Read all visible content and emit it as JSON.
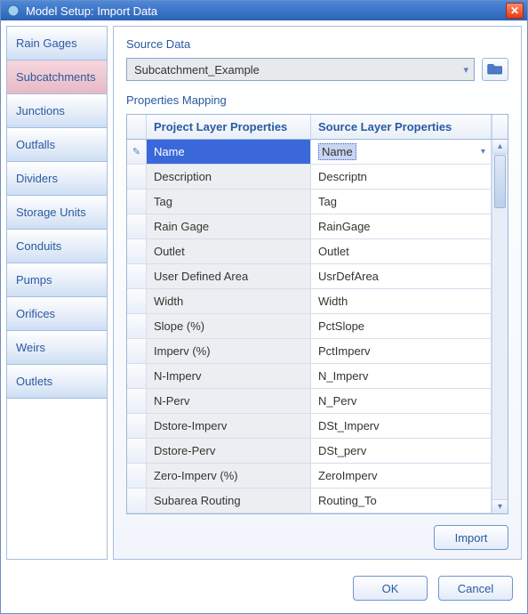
{
  "window": {
    "title": "Model Setup: Import Data"
  },
  "tabs": [
    {
      "label": "Rain Gages"
    },
    {
      "label": "Subcatchments"
    },
    {
      "label": "Junctions"
    },
    {
      "label": "Outfalls"
    },
    {
      "label": "Dividers"
    },
    {
      "label": "Storage Units"
    },
    {
      "label": "Conduits"
    },
    {
      "label": "Pumps"
    },
    {
      "label": "Orifices"
    },
    {
      "label": "Weirs"
    },
    {
      "label": "Outlets"
    }
  ],
  "active_tab_index": 1,
  "source_data": {
    "label": "Source Data",
    "value": "Subcatchment_Example"
  },
  "mapping": {
    "label": "Properties Mapping",
    "col_left": "Project Layer Properties",
    "col_right": "Source Layer Properties",
    "rows": [
      {
        "project": "Name",
        "source": "Name"
      },
      {
        "project": "Description",
        "source": "Descriptn"
      },
      {
        "project": "Tag",
        "source": "Tag"
      },
      {
        "project": "Rain Gage",
        "source": "RainGage"
      },
      {
        "project": "Outlet",
        "source": "Outlet"
      },
      {
        "project": "User Defined Area",
        "source": "UsrDefArea"
      },
      {
        "project": "Width",
        "source": "Width"
      },
      {
        "project": "Slope (%)",
        "source": "PctSlope"
      },
      {
        "project": "Imperv (%)",
        "source": "PctImperv"
      },
      {
        "project": "N-Imperv",
        "source": "N_Imperv"
      },
      {
        "project": "N-Perv",
        "source": "N_Perv"
      },
      {
        "project": "Dstore-Imperv",
        "source": "DSt_Imperv"
      },
      {
        "project": "Dstore-Perv",
        "source": "DSt_perv"
      },
      {
        "project": "Zero-Imperv (%)",
        "source": "ZeroImperv"
      },
      {
        "project": "Subarea Routing",
        "source": "Routing_To"
      }
    ],
    "selected_row_index": 0
  },
  "buttons": {
    "import": "Import",
    "ok": "OK",
    "cancel": "Cancel"
  }
}
